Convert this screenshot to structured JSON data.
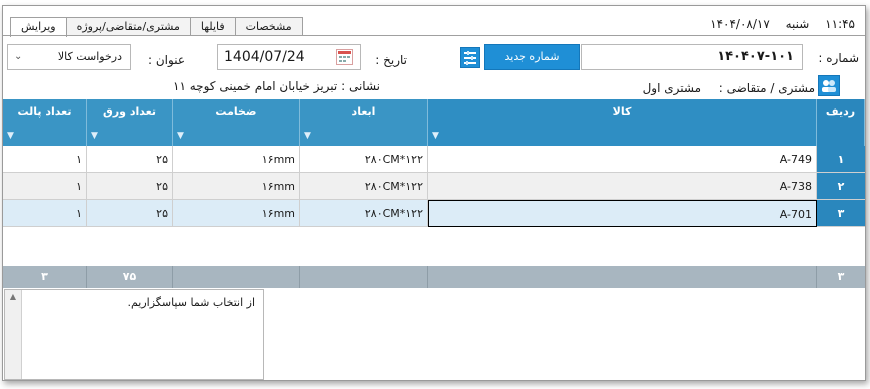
{
  "header": {
    "time": "۱۱:۴۵",
    "day": "شنبه",
    "date": "۱۴۰۴/۰۸/۱۷"
  },
  "tabs": [
    "ویرایش",
    "مشتری/متقاضی/پروژه",
    "فایلها",
    "مشخصات"
  ],
  "form": {
    "number_label": "شماره :",
    "number_value": "۱۴۰۴۰۷-۱۰۱",
    "new_number_button": "شماره جدید",
    "date_label": "تاریخ :",
    "date_value": "1404/07/24",
    "title_label": "عنوان :",
    "title_value": "درخواست کالا",
    "customer_label": "مشتری / متقاضی :",
    "customer_value": "مشتری اول",
    "address_label": "نشانی :",
    "address_value": "تبریز خیابان امام خمینی کوچه ۱۱"
  },
  "grid": {
    "headers": {
      "row": "ردیف",
      "item": "کالا",
      "dims": "ابعاد",
      "thick": "ضخامت",
      "sheets": "تعداد ورق",
      "pallets": "تعداد پالت"
    },
    "rows": [
      {
        "n": "۱",
        "item": "A-749",
        "dims": "۲۸۰CM*۱۲۲",
        "thick": "۱۶mm",
        "sheets": "۲۵",
        "pallets": "۱"
      },
      {
        "n": "۲",
        "item": "A-738",
        "dims": "۲۸۰CM*۱۲۲",
        "thick": "۱۶mm",
        "sheets": "۲۵",
        "pallets": "۱"
      },
      {
        "n": "۳",
        "item": "A-701",
        "dims": "۲۸۰CM*۱۲۲",
        "thick": "۱۶mm",
        "sheets": "۲۵",
        "pallets": "۱"
      }
    ],
    "footer": {
      "count": "۳",
      "sheets_total": "۷۵",
      "pallets_total": "۳"
    }
  },
  "notes": "از انتخاب شما سپاسگزاریم.",
  "colors": {
    "header_blue": "#3a95c5",
    "accent": "#1f8fd6",
    "selected_row": "#dcecf7"
  }
}
